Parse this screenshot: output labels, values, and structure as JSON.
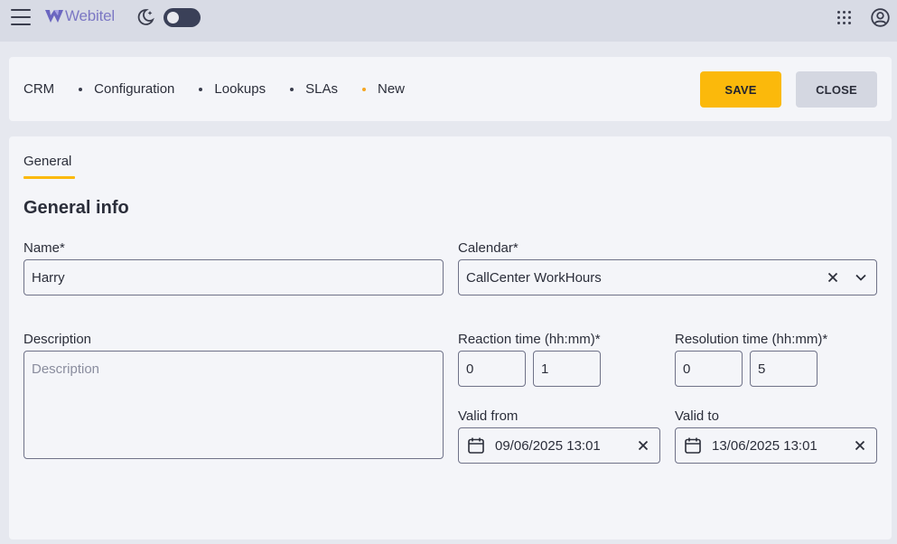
{
  "header": {
    "brand": "Webitel",
    "icons": [
      "menu-icon",
      "webitel-logo-icon",
      "moon-icon",
      "apps-grid-icon",
      "account-icon"
    ],
    "theme_toggle": "off"
  },
  "breadcrumbs": [
    "CRM",
    "Configuration",
    "Lookups",
    "SLAs",
    "New"
  ],
  "actions": {
    "save": "SAVE",
    "close": "CLOSE"
  },
  "tabs": [
    {
      "label": "General",
      "active": true
    }
  ],
  "form": {
    "section_title": "General info",
    "name": {
      "label": "Name*",
      "value": "Harry"
    },
    "calendar": {
      "label": "Calendar*",
      "value": "CallCenter WorkHours"
    },
    "description": {
      "label": "Description",
      "value": "",
      "placeholder": "Description"
    },
    "reaction_time": {
      "label": "Reaction time (hh:mm)*",
      "hours": "0",
      "minutes": "1"
    },
    "resolution_time": {
      "label": "Resolution time (hh:mm)*",
      "hours": "0",
      "minutes": "5"
    },
    "valid_from": {
      "label": "Valid from",
      "value": "09/06/2025 13:01"
    },
    "valid_to": {
      "label": "Valid to",
      "value": "13/06/2025 13:01"
    }
  },
  "colors": {
    "accent": "#fbb90b",
    "header_bg": "#d8dbe5",
    "page_bg": "#e6e8ef",
    "panel_bg": "#f4f5f9",
    "brand": "#7c78c4",
    "active_crumb_dot": "#f5a623"
  }
}
